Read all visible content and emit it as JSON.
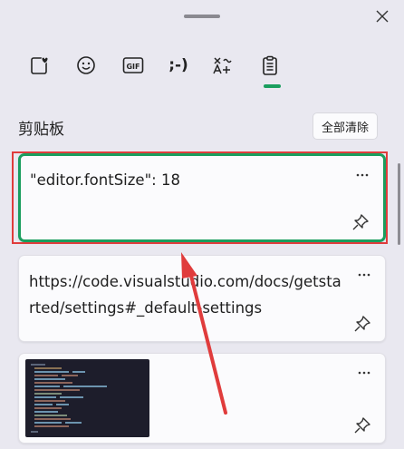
{
  "panel": {
    "title": "剪贴板",
    "clear_all_label": "全部清除"
  },
  "tabs": [
    {
      "name": "favorites",
      "icon": "heart-card-icon"
    },
    {
      "name": "emoji",
      "icon": "smiley-icon"
    },
    {
      "name": "gif",
      "icon": "gif-icon",
      "label": "GIF"
    },
    {
      "name": "kaomoji",
      "icon": "kaomoji-icon",
      "label": ";-)"
    },
    {
      "name": "symbols",
      "icon": "symbols-icon"
    },
    {
      "name": "clipboard",
      "icon": "clipboard-icon",
      "selected": true
    }
  ],
  "items": [
    {
      "text": "\"editor.fontSize\": 18",
      "type": "text",
      "selected": true
    },
    {
      "text": "https://code.visualstudio.com/docs/getstarted/settings#_default-settings",
      "type": "text"
    },
    {
      "type": "image",
      "description_icon": "code-screenshot-thumbnail"
    }
  ],
  "colors": {
    "accent": "#1a9e5e",
    "annotation": "#e03c3c",
    "background": "#e9e8f0"
  }
}
